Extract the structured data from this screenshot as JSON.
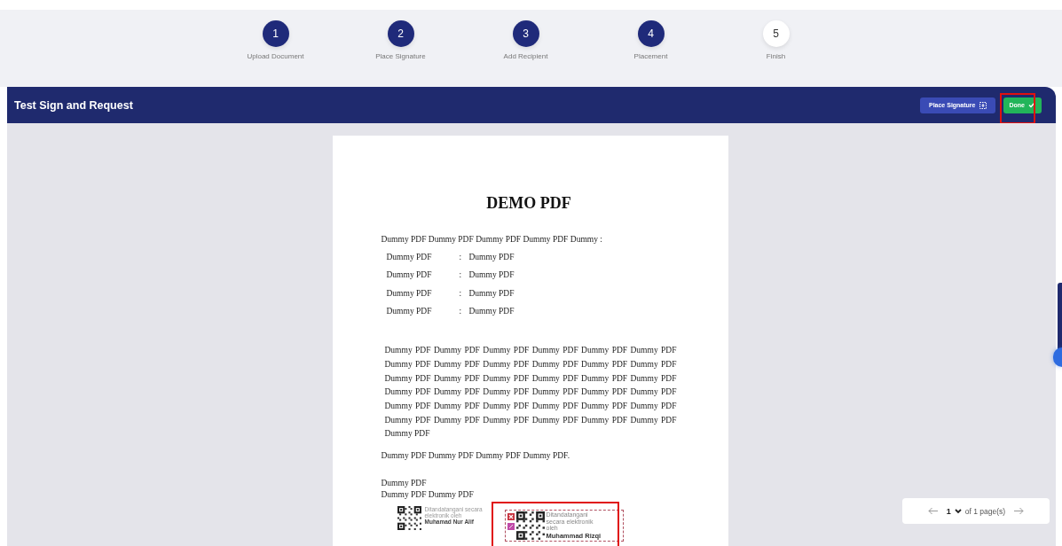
{
  "steps": [
    {
      "number": "1",
      "label": "Upload Document",
      "done": true
    },
    {
      "number": "2",
      "label": "Place Signature",
      "done": true
    },
    {
      "number": "3",
      "label": "Add Recipient",
      "done": true
    },
    {
      "number": "4",
      "label": "Placement",
      "done": true
    },
    {
      "number": "5",
      "label": "Finish",
      "done": false
    }
  ],
  "header": {
    "title": "Test Sign and Request",
    "buttons": [
      {
        "label": "Place Signature",
        "kind": "secondary",
        "highlighted": false
      },
      {
        "label": "Done",
        "kind": "primary",
        "highlighted": true
      }
    ]
  },
  "document": {
    "title": "DEMO PDF",
    "intro": "Dummy PDF Dummy PDF Dummy PDF Dummy PDF Dummy :",
    "fields": [
      {
        "label": "Dummy PDF",
        "separator": ":",
        "value": "Dummy PDF"
      },
      {
        "label": "Dummy PDF",
        "separator": ":",
        "value": "Dummy PDF"
      },
      {
        "label": "Dummy PDF",
        "separator": ":",
        "value": "Dummy PDF"
      },
      {
        "label": "Dummy PDF",
        "separator": ":",
        "value": "Dummy PDF"
      }
    ],
    "paragraph": "Dummy PDF Dummy PDF Dummy PDF Dummy PDF Dummy PDF Dummy PDF Dummy PDF Dummy PDF Dummy PDF Dummy PDF Dummy PDF Dummy PDF Dummy PDF Dummy PDF Dummy PDF Dummy PDF Dummy PDF Dummy PDF Dummy PDF Dummy PDF Dummy PDF Dummy PDF Dummy PDF Dummy PDF Dummy PDF Dummy PDF Dummy PDF Dummy PDF Dummy PDF Dummy PDF Dummy PDF Dummy PDF Dummy PDF Dummy PDF Dummy PDF Dummy PDF Dummy PDF",
    "sentence": "Dummy PDF Dummy PDF Dummy PDF Dummy PDF.",
    "closing": [
      "Dummy PDF",
      "Dummy PDF Dummy PDF"
    ],
    "signatures": [
      {
        "caption": "Ditandatangani secara elektronik oleh",
        "name": "Muhamad Nur Alif",
        "editing": false,
        "highlighted": false
      },
      {
        "caption": "Ditandatangani secara elektronik oleh",
        "name": "Muhammad Rizqi",
        "editing": true,
        "highlighted": true
      }
    ]
  },
  "pager": {
    "page": "1",
    "total_label": "of 1 page(s)"
  }
}
